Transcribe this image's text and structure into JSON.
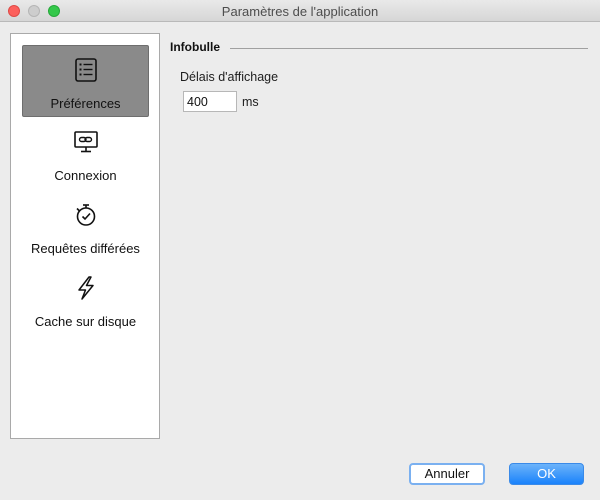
{
  "window": {
    "title": "Paramètres de l'application"
  },
  "sidebar": {
    "items": [
      {
        "label": "Préférences",
        "icon": "list-icon",
        "selected": true
      },
      {
        "label": "Connexion",
        "icon": "monitor-link-icon",
        "selected": false
      },
      {
        "label": "Requêtes différées",
        "icon": "stopwatch-icon",
        "selected": false
      },
      {
        "label": "Cache sur disque",
        "icon": "lightning-icon",
        "selected": false
      }
    ]
  },
  "main": {
    "section_title": "Infobulle",
    "delay_label": "Délais d'affichage",
    "delay_value": "400",
    "delay_unit": "ms"
  },
  "footer": {
    "cancel_label": "Annuler",
    "ok_label": "OK"
  },
  "colors": {
    "selected_bg": "#8a8a8a",
    "ok_blue": "#1a82fb",
    "close": "#fc605c",
    "maximize": "#34c84a"
  }
}
